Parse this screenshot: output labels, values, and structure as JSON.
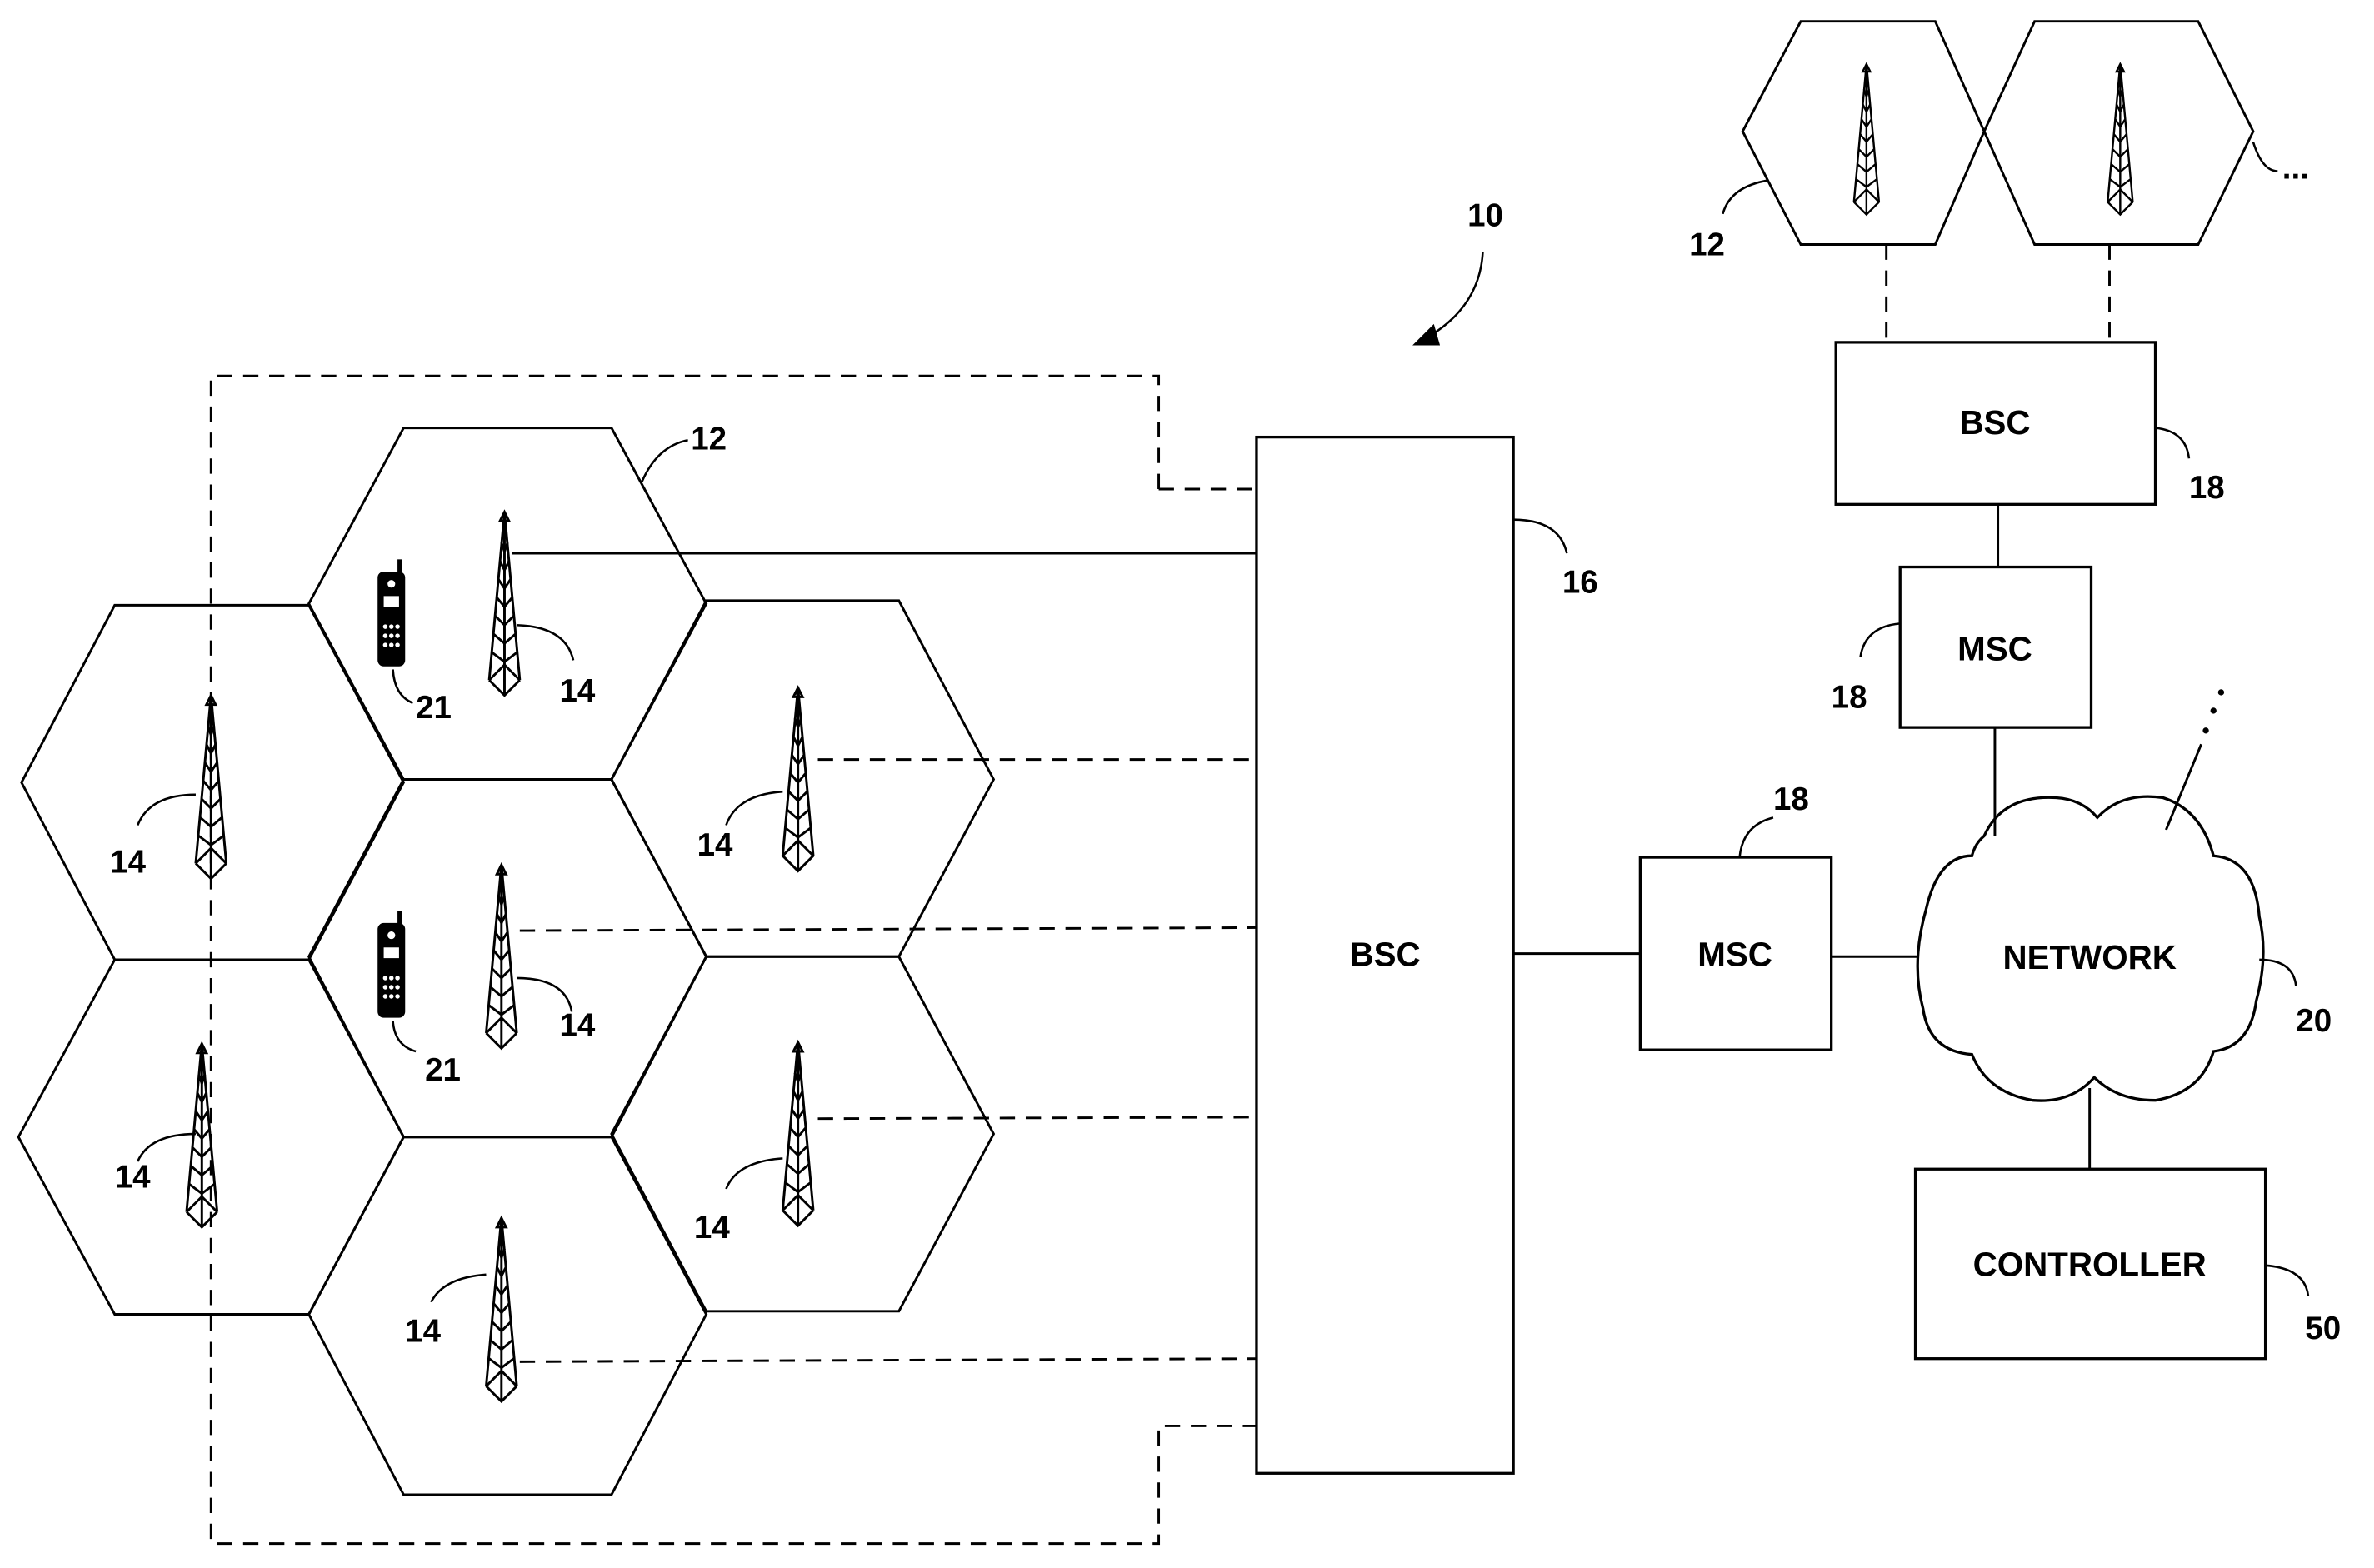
{
  "figure": {
    "system_ref": "10",
    "cell_ref": "12",
    "base_station_ref": "14",
    "mobile_ref": "21",
    "main_bsc": {
      "label": "BSC",
      "ref": "16"
    },
    "main_msc": {
      "label": "MSC",
      "ref": "18"
    },
    "remote_bsc": {
      "label": "BSC",
      "ref": "18"
    },
    "remote_msc": {
      "label": "MSC",
      "ref": "18"
    },
    "network": {
      "label": "NETWORK",
      "ref": "20"
    },
    "controller": {
      "label": "CONTROLLER",
      "ref": "50"
    },
    "remote_cells_ref": "12",
    "continuation": "...",
    "network_continuation": "..."
  },
  "icons": {
    "tower": "cell-tower-icon",
    "phone": "mobile-phone-icon",
    "cloud": "network-cloud-icon"
  }
}
